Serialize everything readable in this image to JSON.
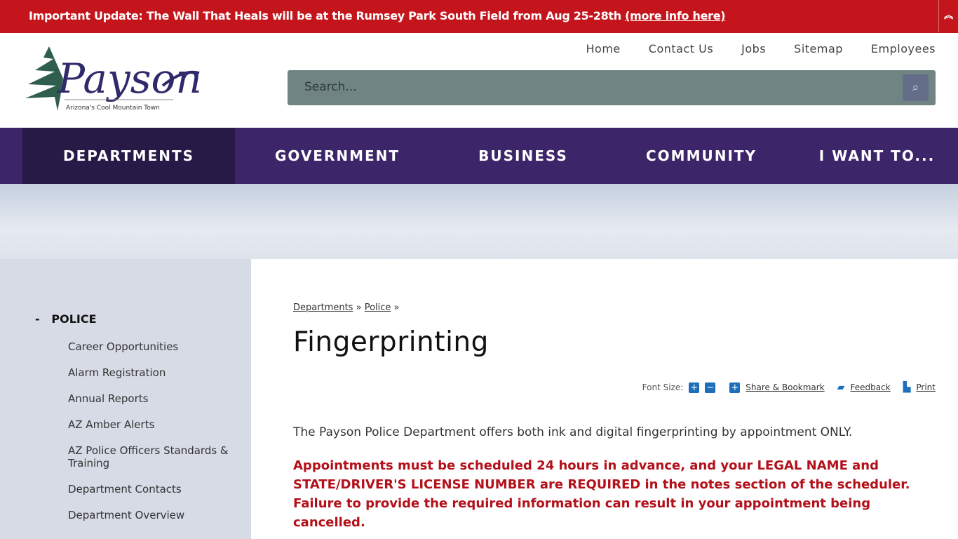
{
  "alert": {
    "text": "Important Update: The Wall That Heals will be at the Rumsey Park South Field from Aug 25-28th ",
    "link": "(more info here)",
    "toggle_icon": "double-chevron-up-icon"
  },
  "logo": {
    "name": "Payson",
    "tagline": "Arizona's Cool Mountain Town"
  },
  "topnav": [
    "Home",
    "Contact Us",
    "Jobs",
    "Sitemap",
    "Employees"
  ],
  "search": {
    "placeholder": "Search...",
    "icon": "search-icon"
  },
  "mainnav": [
    "DEPARTMENTS",
    "GOVERNMENT",
    "BUSINESS",
    "COMMUNITY",
    "I WANT TO..."
  ],
  "sidebar": {
    "head_marker": "-",
    "head": "POLICE",
    "items": [
      "Career Opportunities",
      "Alarm Registration",
      "Annual Reports",
      "AZ Amber Alerts",
      "AZ Police Officers Standards & Training",
      "Department Contacts",
      "Department Overview"
    ]
  },
  "breadcrumb": {
    "items": [
      "Departments",
      "Police"
    ],
    "sep": "»"
  },
  "page": {
    "title": "Fingerprinting",
    "intro": "The Payson Police Department offers both ink and digital fingerprinting by appointment ONLY.",
    "notice": "Appointments must be scheduled 24 hours in advance, and your LEGAL NAME and STATE/DRIVER'S LICENSE NUMBER are REQUIRED in the notes section of the scheduler. Failure to provide the required information can result in your appointment being cancelled."
  },
  "tools": {
    "font_size": "Font Size:",
    "increase": "+",
    "decrease": "−",
    "share_icon": "+",
    "share": "Share & Bookmark",
    "feedback": "Feedback",
    "print": "Print"
  },
  "colors": {
    "alert": "#c4151c",
    "nav": "#3c2669",
    "nav_active": "#281a47",
    "notice": "#b3101a",
    "accent": "#1d6fbb"
  }
}
